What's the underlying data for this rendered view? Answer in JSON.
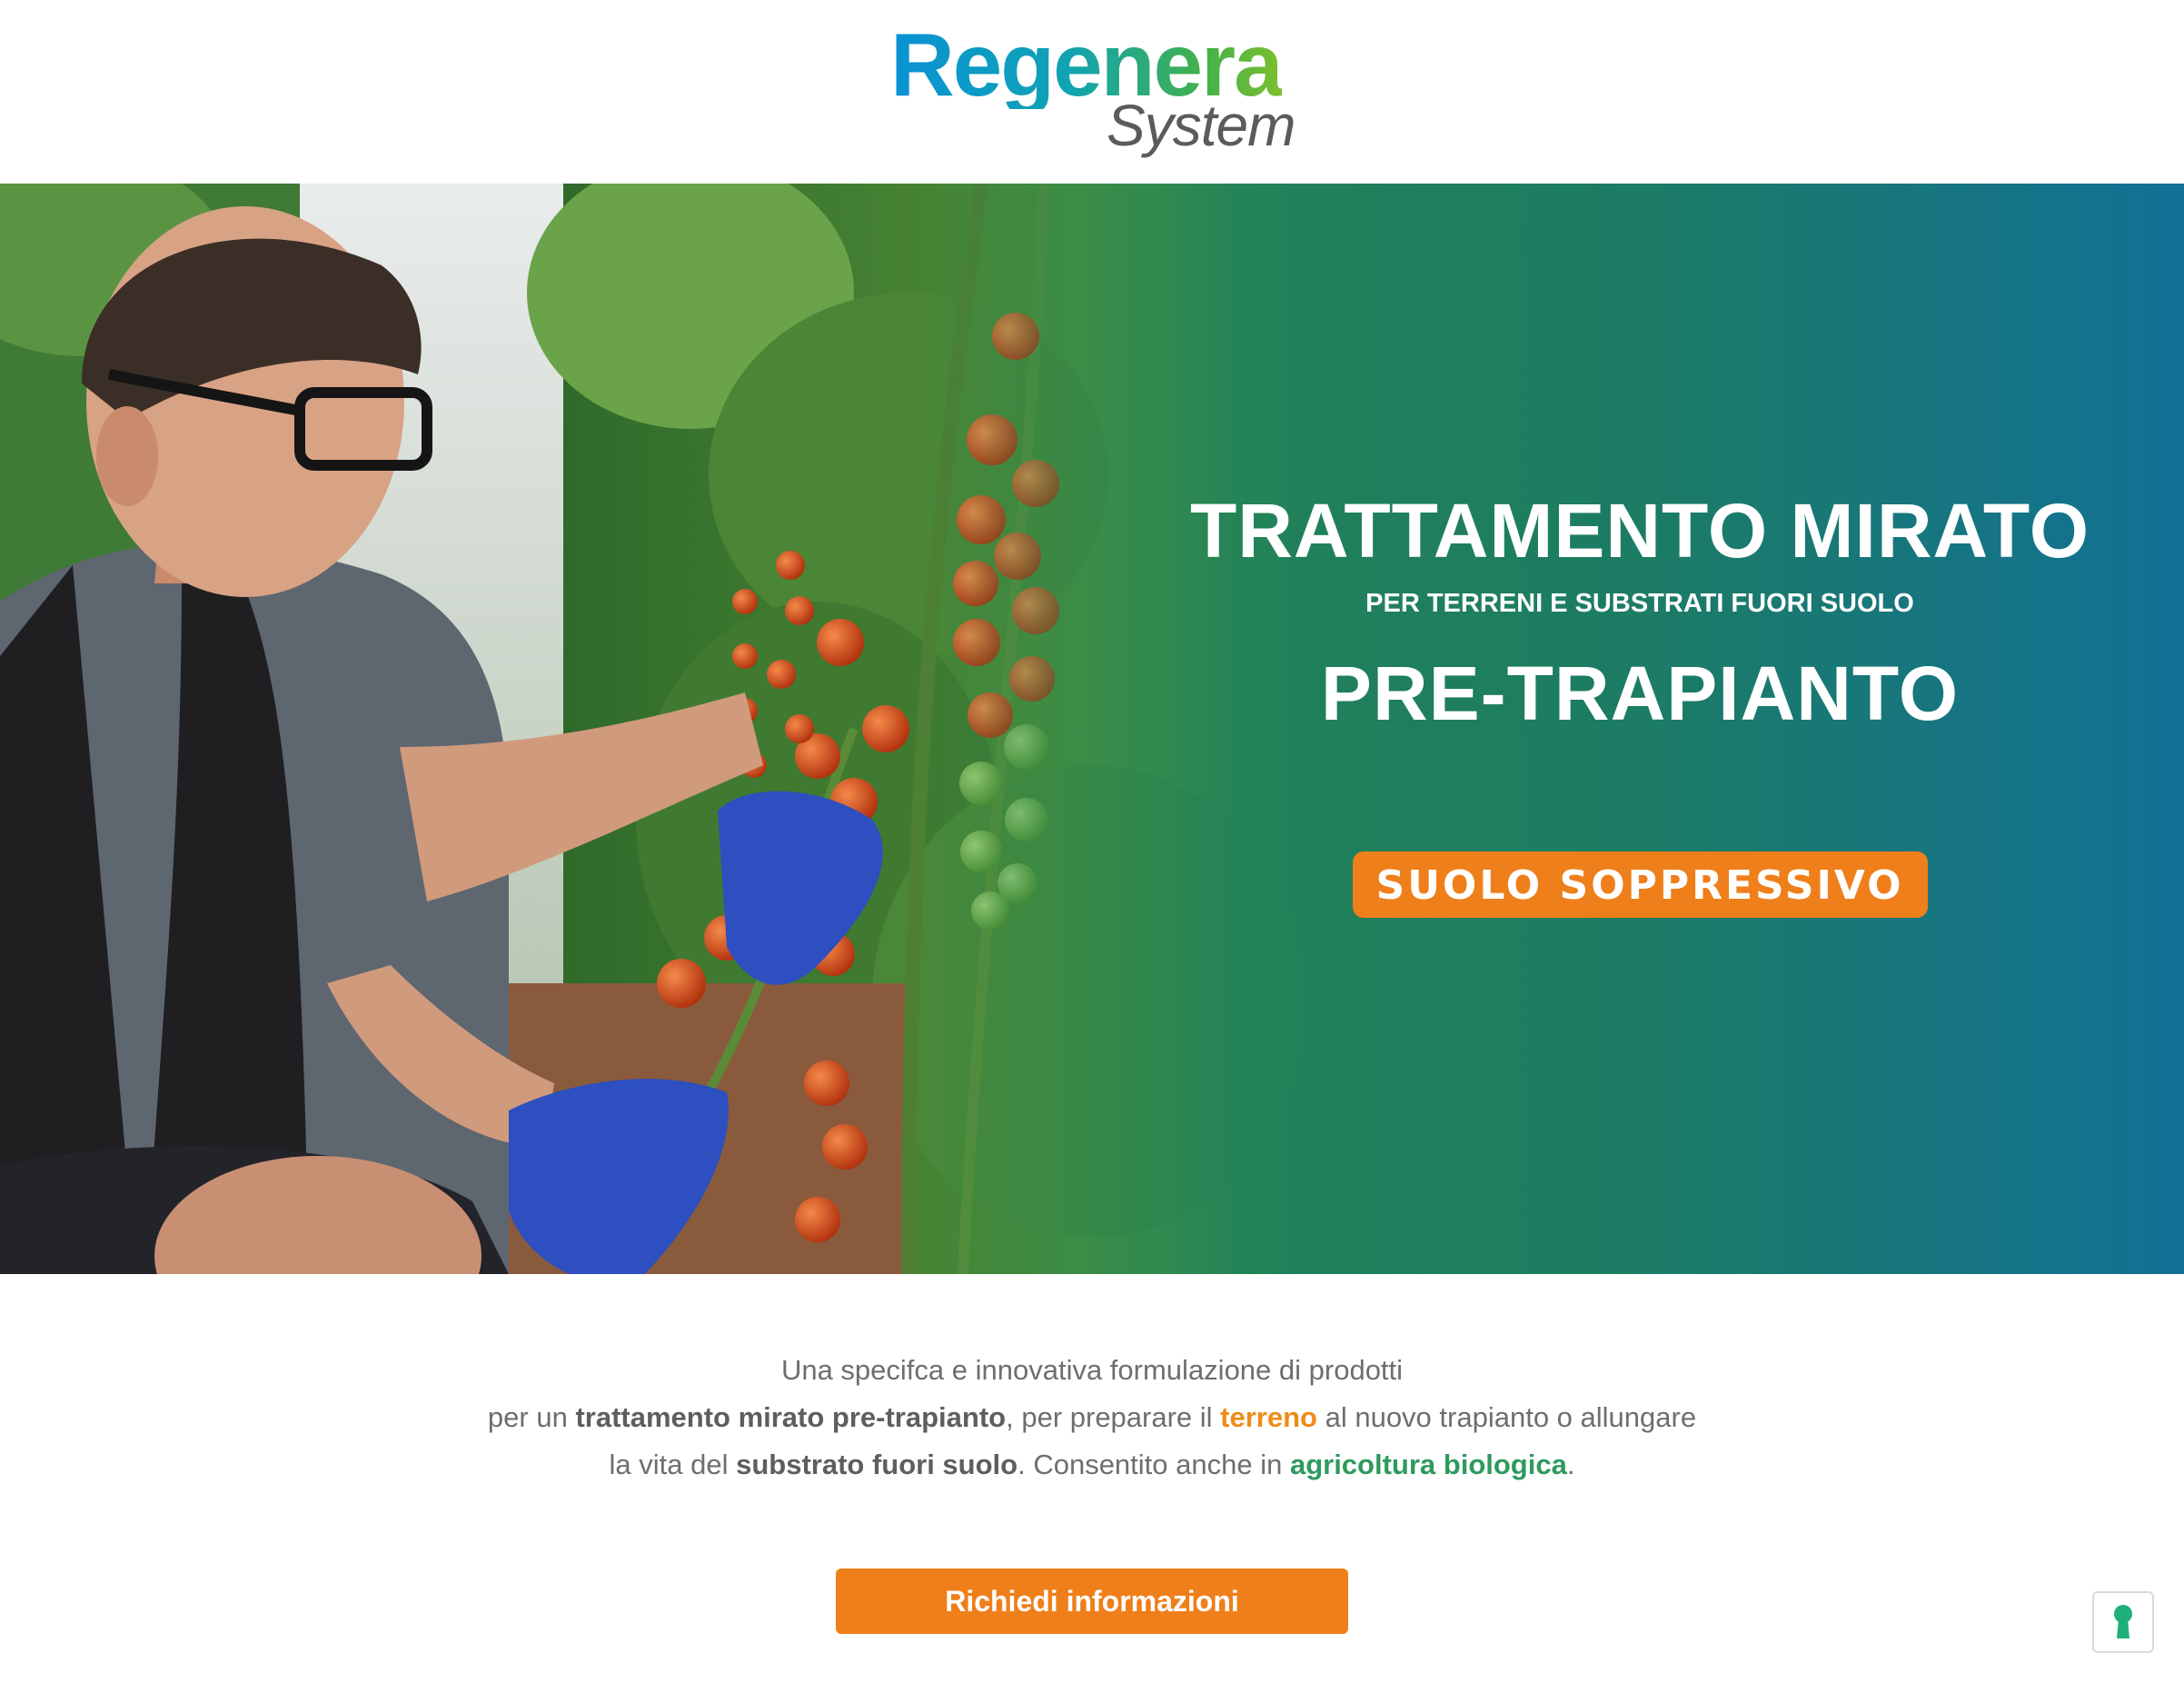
{
  "header": {
    "logo": {
      "line1": "Regenera",
      "line2": "System"
    }
  },
  "hero": {
    "title": "TRATTAMENTO MIRATO",
    "subtitle": "PER TERRENI E SUBSTRATI FUORI SUOLO",
    "title2": "PRE-TRAPIANTO",
    "badge": "SUOLO SOPPRESSIVO"
  },
  "description": {
    "line1": "Una specifca e innovativa formulazione di prodotti",
    "line2_a": "per un ",
    "line2_bold": "trattamento mirato pre-trapianto",
    "line2_b": ", per preparare il ",
    "line2_orange": "terreno",
    "line2_c": " al nuovo trapianto o allungare",
    "line3_a": "la vita del ",
    "line3_bold": "substrato fuori suolo",
    "line3_b": ". Consentito anche in ",
    "line3_green": "agricoltura biologica",
    "line3_c": "."
  },
  "cta": {
    "label": "Richiedi informazioni"
  },
  "widgets": {
    "accessibility_icon": "keyhole-icon"
  },
  "colors": {
    "accent_orange": "#ef7f1a",
    "brand_green": "#2f9a5e",
    "brand_blue": "#0a92d4",
    "hero_teal": "#1c7c64"
  }
}
